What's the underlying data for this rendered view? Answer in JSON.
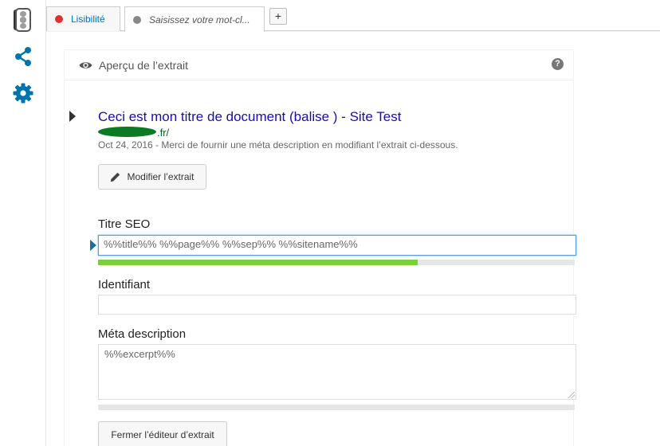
{
  "sidebar": {
    "icons": [
      "traffic-light-icon",
      "share-icon",
      "gear-icon"
    ],
    "accent": "#0073aa"
  },
  "tabs": [
    {
      "label": "Lisibilité",
      "status_color": "#dc3232"
    },
    {
      "label": "Saisissez votre mot-cl...",
      "status_color": "#888888"
    }
  ],
  "add_tab_label": "+",
  "panel": {
    "title": "Aperçu de l’extrait",
    "help_label": "?"
  },
  "snippet": {
    "title": "Ceci est mon titre de document (balise ) - Site Test",
    "url_suffix": ".fr/",
    "description": "Oct 24, 2016 - Merci de fournir une méta description en modifiant l’extrait ci-dessous."
  },
  "edit_button_label": "Modifier l’extrait",
  "seo_title": {
    "label": "Titre SEO",
    "value": "%%title%% %%page%% %%sep%% %%sitename%%",
    "progress": 0.67,
    "progress_color": "#7ad03a"
  },
  "slug": {
    "label": "Identifiant",
    "value": ""
  },
  "meta_description": {
    "label": "Méta description",
    "value": "%%excerpt%%",
    "progress": 0
  },
  "close_button_label": "Fermer l’éditeur d’extrait"
}
